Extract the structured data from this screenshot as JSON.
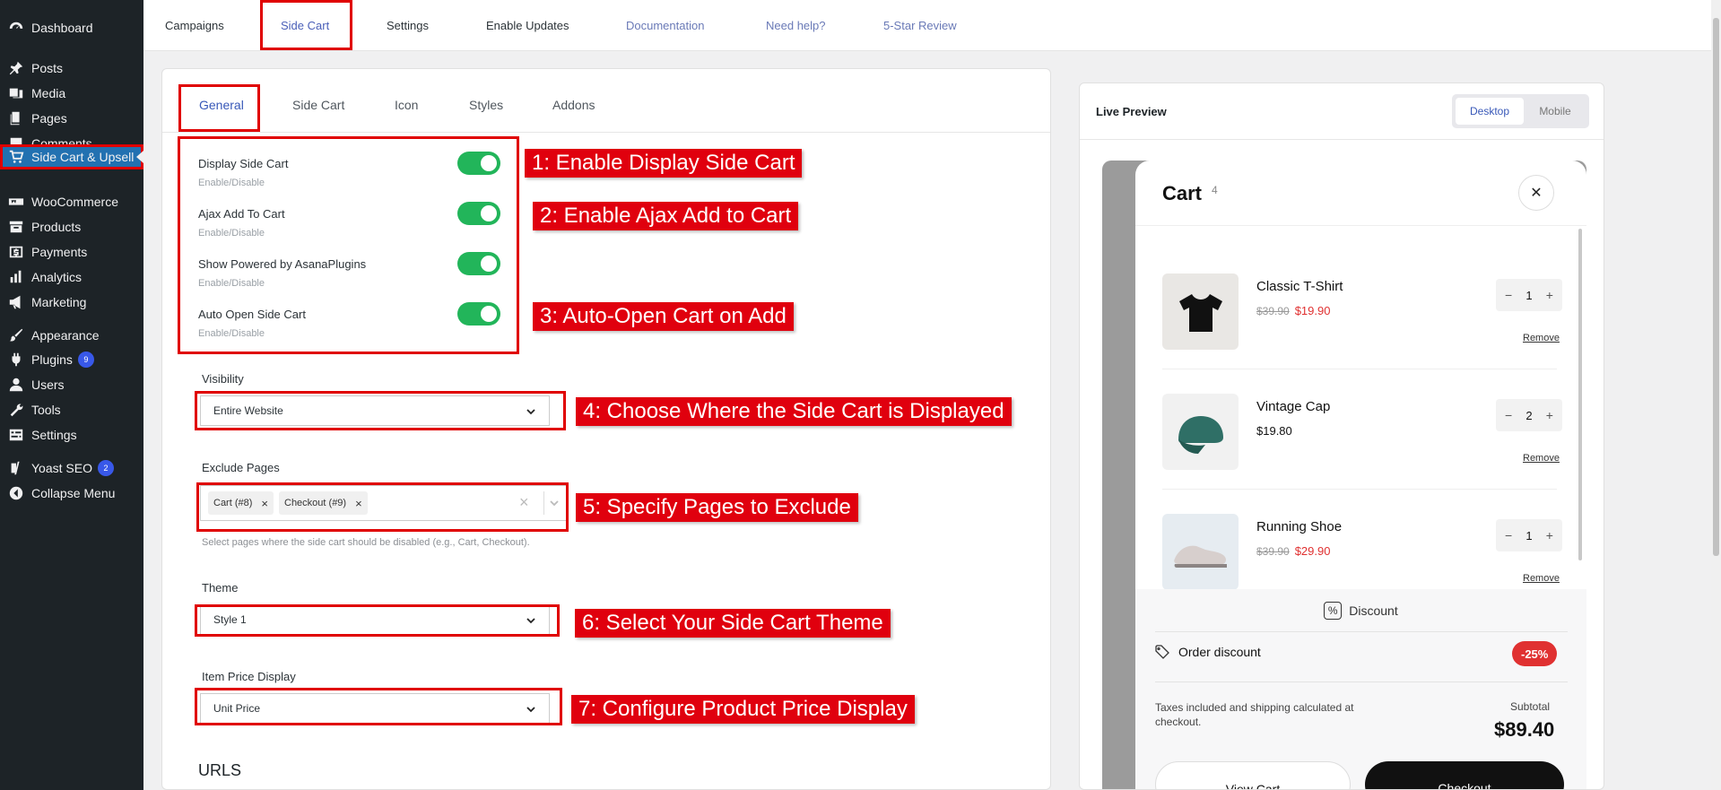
{
  "sidebar": {
    "items": [
      {
        "label": "Dashboard",
        "icon": "dashboard-icon"
      },
      {
        "label": "Posts",
        "icon": "pin-icon"
      },
      {
        "label": "Media",
        "icon": "media-icon"
      },
      {
        "label": "Pages",
        "icon": "pages-icon"
      },
      {
        "label": "Comments",
        "icon": "comment-icon"
      },
      {
        "label": "Side Cart & Upsell",
        "icon": "cart-icon"
      },
      {
        "label": "WooCommerce",
        "icon": "woo-icon"
      },
      {
        "label": "Products",
        "icon": "archive-icon"
      },
      {
        "label": "Payments",
        "icon": "dollar-icon"
      },
      {
        "label": "Analytics",
        "icon": "chart-bar-icon"
      },
      {
        "label": "Marketing",
        "icon": "megaphone-icon"
      },
      {
        "label": "Appearance",
        "icon": "brush-icon"
      },
      {
        "label": "Plugins",
        "icon": "plug-icon",
        "badge": "9"
      },
      {
        "label": "Users",
        "icon": "user-icon"
      },
      {
        "label": "Tools",
        "icon": "wrench-icon"
      },
      {
        "label": "Settings",
        "icon": "settings-icon"
      },
      {
        "label": "Yoast SEO",
        "icon": "yoast-icon",
        "badge": "2"
      },
      {
        "label": "Collapse Menu",
        "icon": "collapse-icon"
      }
    ]
  },
  "topnav": {
    "tabs": [
      "Campaigns",
      "Side Cart",
      "Settings",
      "Enable Updates",
      "Documentation",
      "Need help?",
      "5-Star Review"
    ]
  },
  "subnav": {
    "tabs": [
      "General",
      "Side Cart",
      "Icon",
      "Styles",
      "Addons"
    ]
  },
  "settings": [
    {
      "title": "Display Side Cart",
      "sub": "Enable/Disable",
      "enabled": true
    },
    {
      "title": "Ajax Add To Cart",
      "sub": "Enable/Disable",
      "enabled": true
    },
    {
      "title": "Show Powered by AsanaPlugins",
      "sub": "Enable/Disable",
      "enabled": true
    },
    {
      "title": "Auto Open Side Cart",
      "sub": "Enable/Disable",
      "enabled": true
    }
  ],
  "fields": {
    "visibility": {
      "label": "Visibility",
      "value": "Entire Website"
    },
    "exclude": {
      "label": "Exclude Pages",
      "chips": [
        "Cart (#8)",
        "Checkout (#9)"
      ],
      "helper": "Select pages where the side cart should be disabled (e.g., Cart, Checkout)."
    },
    "theme": {
      "label": "Theme",
      "value": "Style 1"
    },
    "price_display": {
      "label": "Item Price Display",
      "value": "Unit Price"
    },
    "urls_heading": "URLS"
  },
  "callouts": [
    "1: Enable Display Side Cart",
    "2: Enable Ajax Add to Cart",
    "3: Auto-Open Cart on Add",
    "4: Choose Where the Side Cart is Displayed",
    "5: Specify Pages to Exclude",
    "6: Select Your Side Cart Theme",
    "7: Configure Product Price Display"
  ],
  "preview": {
    "title": "Live Preview",
    "modes": [
      "Desktop",
      "Mobile"
    ],
    "active_mode": "Desktop",
    "cart": {
      "title": "Cart",
      "count": "4",
      "items": [
        {
          "name": "Classic T-Shirt",
          "old_price": "$39.90",
          "price": "$19.90",
          "qty": "1",
          "on_sale": true
        },
        {
          "name": "Vintage Cap",
          "old_price": "",
          "price": "$19.80",
          "qty": "2",
          "on_sale": false
        },
        {
          "name": "Running Shoe",
          "old_price": "$39.90",
          "price": "$29.90",
          "qty": "1",
          "on_sale": true
        }
      ],
      "remove_label": "Remove",
      "discount_heading": "Discount",
      "order_discount_label": "Order discount",
      "order_discount_value": "-25%",
      "tax_note": "Taxes included and shipping calculated at checkout.",
      "subtotal_label": "Subtotal",
      "subtotal_value": "$89.40",
      "view_cart_label": "View Cart",
      "checkout_label": "Checkout"
    }
  },
  "colors": {
    "accent": "#3858e9",
    "toggle_on": "#22b55a",
    "annotation_red": "#e0000e",
    "sale_red": "#e03131"
  }
}
